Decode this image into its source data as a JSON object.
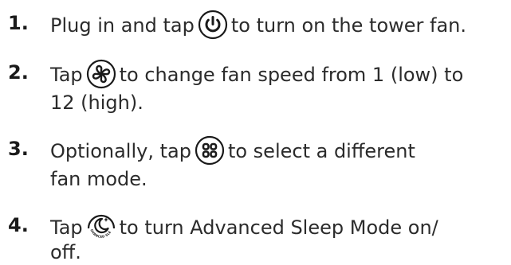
{
  "steps": [
    {
      "number": "1.",
      "before": "Plug in and tap",
      "icon": "power-icon",
      "after": "to turn on the tower fan.",
      "continuation": ""
    },
    {
      "number": "2.",
      "before": "Tap",
      "icon": "fan-icon",
      "after": "to change fan speed from 1 (low) to",
      "continuation": "12 (high)."
    },
    {
      "number": "3.",
      "before": "Optionally, tap",
      "icon": "mode-icon",
      "after": "to select a different",
      "continuation": "fan mode."
    },
    {
      "number": "4.",
      "before": "Tap",
      "icon": "sleep-icon",
      "icon_text": "ADVANCED SLEEP",
      "after": "to turn Advanced Sleep Mode on/",
      "continuation": "off."
    }
  ],
  "colors": {
    "text": "#2b2b2b",
    "number": "#1a1a1a",
    "icon": "#1a1a1a"
  }
}
